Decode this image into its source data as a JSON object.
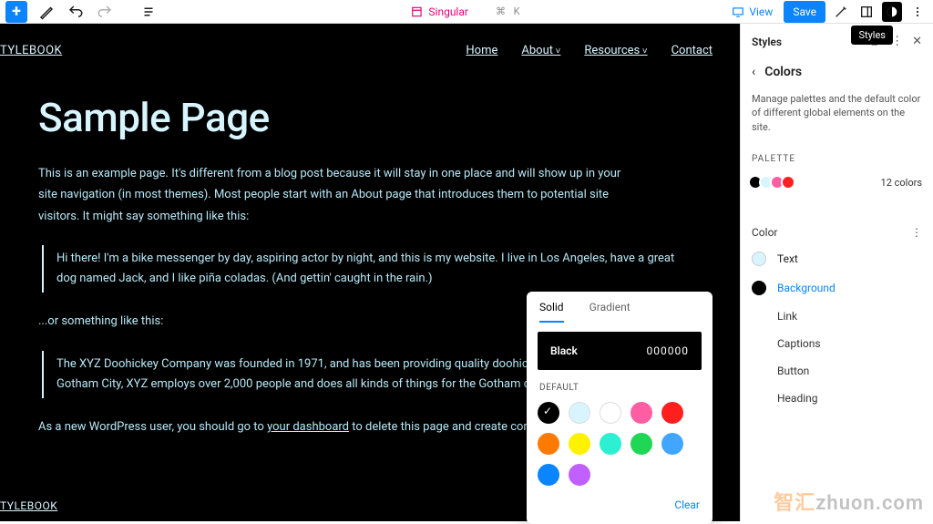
{
  "toolbar": {
    "add": "+",
    "singular_label": "Singular",
    "cmdk": "⌘ K",
    "view_label": "View",
    "save_label": "Save"
  },
  "tooltip": "Styles",
  "site": {
    "title": "TYLEBOOK",
    "nav": {
      "home": "Home",
      "about": "About",
      "resources": "Resources",
      "contact": "Contact"
    },
    "footer_title": "TYLEBOOK"
  },
  "page": {
    "title": "Sample Page",
    "para1": "This is an example page. It's different from a blog post because it will stay in one place and will show up in your site navigation (in most themes). Most people start with an About page that introduces them to potential site visitors. It might say something like this:",
    "quote1": "Hi there! I'm a bike messenger by day, aspiring actor by night, and this is my website. I live in Los Angeles, have a great dog named Jack, and I like piña coladas. (And gettin' caught in the rain.)",
    "para2": "...or something like this:",
    "quote2": "The XYZ Doohickey Company was founded in 1971, and has been providing quality doohickeys ever since. Located in Gotham City, XYZ employs over 2,000 people and does all kinds of things for the Gotham community.",
    "para3_pre": "As a new WordPress user, you should go to ",
    "para3_link": "your dashboard",
    "para3_post": " to delete this page and create content. Have fun!"
  },
  "picker": {
    "tab_solid": "Solid",
    "tab_gradient": "Gradient",
    "color_name": "Black",
    "color_hex": "000000",
    "default_label": "DEFAULT",
    "clear": "Clear",
    "swatches": [
      "#000000",
      "#d8f5ff",
      "#ffffff00",
      "#ff5fa2",
      "#ff1f1f",
      "#ff7a00",
      "#fff200",
      "#2cf0d1",
      "#1fd655",
      "#41a6ff",
      "#0a84ff",
      "#c060ff"
    ]
  },
  "sidepanel": {
    "title": "Styles",
    "crumb": "Colors",
    "desc": "Manage palettes and the default color of different global elements on the site.",
    "palette_label": "PALETTE",
    "palette_count": "12 colors",
    "color_label": "Color",
    "elements": {
      "text": "Text",
      "background": "Background",
      "link": "Link",
      "captions": "Captions",
      "button": "Button",
      "heading": "Heading"
    }
  },
  "watermark": {
    "zh": "智汇",
    "py": "zhuon.com"
  }
}
